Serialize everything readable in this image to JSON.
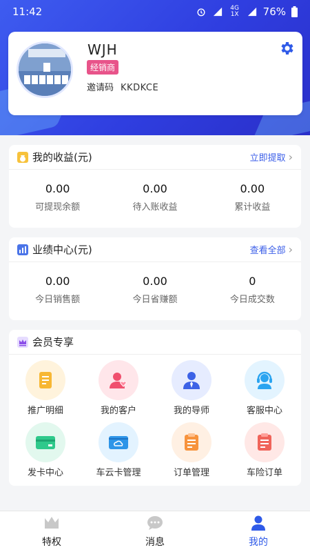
{
  "status_bar": {
    "time": "11:42",
    "network": "4G 1X",
    "battery": "76%"
  },
  "profile": {
    "name": "WJH",
    "badge": "经销商",
    "invite_label": "邀请码",
    "invite_code": "KKDKCE"
  },
  "earnings": {
    "title": "我的收益(元)",
    "link": "立即提取",
    "stats": [
      {
        "value": "0.00",
        "label": "可提现余额"
      },
      {
        "value": "0.00",
        "label": "待入账收益"
      },
      {
        "value": "0.00",
        "label": "累计收益"
      }
    ]
  },
  "performance": {
    "title": "业绩中心(元)",
    "link": "查看全部",
    "stats": [
      {
        "value": "0.00",
        "label": "今日销售额"
      },
      {
        "value": "0.00",
        "label": "今日省赚额"
      },
      {
        "value": "0",
        "label": "今日成交数"
      }
    ]
  },
  "member": {
    "title": "会员专享",
    "items": [
      {
        "label": "推广明细",
        "icon": "promotion-detail-icon",
        "bg": "#fff3dc",
        "fg": "#f7b733"
      },
      {
        "label": "我的客户",
        "icon": "customers-icon",
        "bg": "#ffe6ea",
        "fg": "#f0506e"
      },
      {
        "label": "我的导师",
        "icon": "mentor-icon",
        "bg": "#e6ecff",
        "fg": "#3c62e6"
      },
      {
        "label": "客服中心",
        "icon": "customer-service-icon",
        "bg": "#e3f4ff",
        "fg": "#2ba4f0"
      },
      {
        "label": "发卡中心",
        "icon": "card-issue-icon",
        "bg": "#e2f8ee",
        "fg": "#2fc98b"
      },
      {
        "label": "车云卡管理",
        "icon": "car-cloud-card-icon",
        "bg": "#e3f3ff",
        "fg": "#2e95e8"
      },
      {
        "label": "订单管理",
        "icon": "order-management-icon",
        "bg": "#fff0e3",
        "fg": "#f7933d"
      },
      {
        "label": "车险订单",
        "icon": "car-insurance-order-icon",
        "bg": "#ffe8e6",
        "fg": "#f0645a"
      }
    ]
  },
  "tabbar": [
    {
      "label": "特权",
      "icon": "crown-icon"
    },
    {
      "label": "消息",
      "icon": "chat-icon"
    },
    {
      "label": "我的",
      "icon": "person-icon",
      "active": true
    }
  ]
}
